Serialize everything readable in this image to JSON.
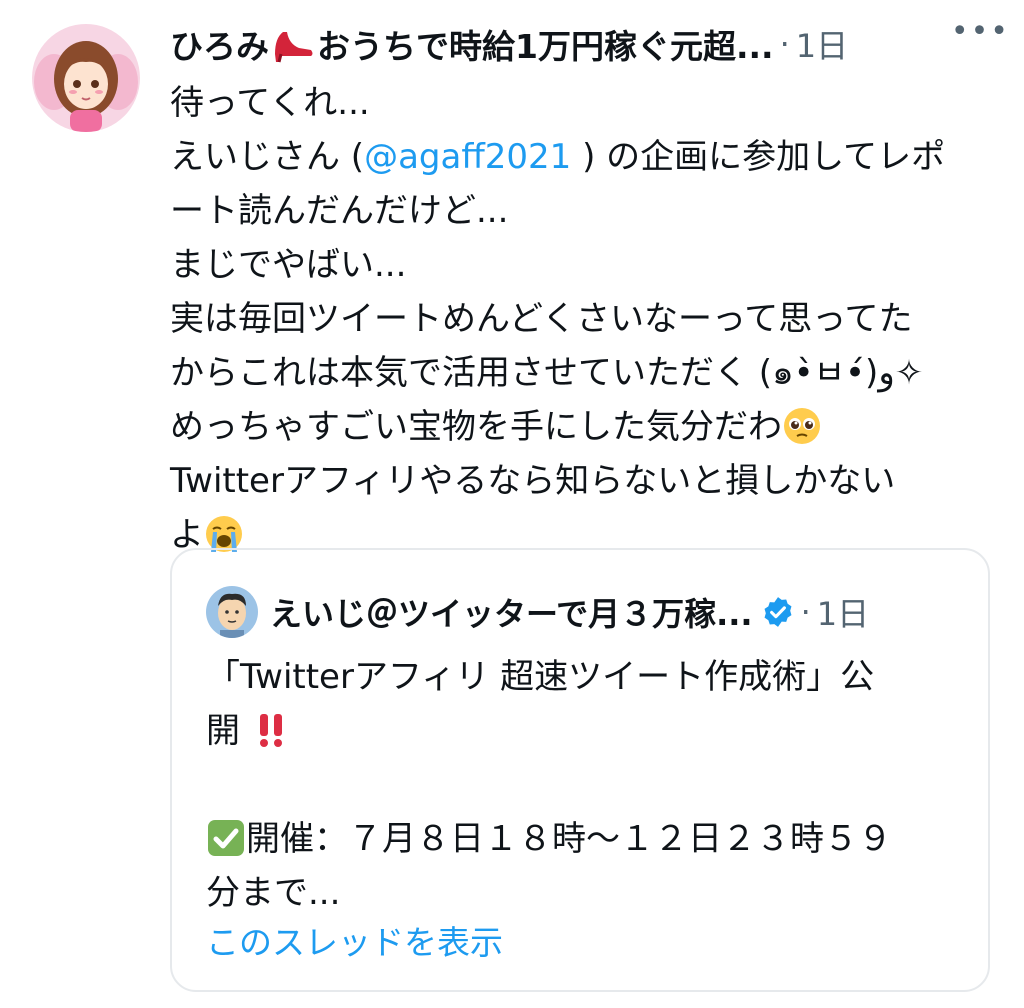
{
  "tweet": {
    "author_name_part1": "ひろみ",
    "author_name_part2": "おうちで時給1万円稼ぐ元超...",
    "separator": "·",
    "time": "1日",
    "more": "•••",
    "body": {
      "l1": "待ってくれ...",
      "l2_prefix": "えいじさん (",
      "l2_mention": "@agaff2021",
      "l2_suffix": " ) の企画に参加してレポ",
      "l3": "ート読んだんだけど...",
      "l4": "まじでやばい...",
      "l5": "実は毎回ツイートめんどくさいなーって思ってた",
      "l6": "からこれは本気で活用させていただく (๑•̀ㅂ•́)و✧",
      "l7": "めっちゃすごい宝物を手にした気分だわ",
      "l8": "Twitterアフィリやるなら知らないと損しかない",
      "l9": "よ"
    }
  },
  "quote": {
    "author_name": "えいじ＠ツイッターで月３万稼...",
    "separator": "·",
    "time": "1日",
    "body": {
      "l1": "「Twitterアフィリ 超速ツイート作成術」公",
      "l2": "開",
      "l2_emoji": "‼️",
      "l3_emoji": "✅",
      "l3": "開催：７月８日１８時〜１２日２３時５９",
      "l4": "分まで..."
    },
    "show_thread": "このスレッドを表示"
  },
  "colors": {
    "link": "#1d9bf0",
    "secondary": "#536471",
    "text": "#0f1419",
    "border": "#e6e9ec",
    "verified": "#1d9bf0"
  }
}
